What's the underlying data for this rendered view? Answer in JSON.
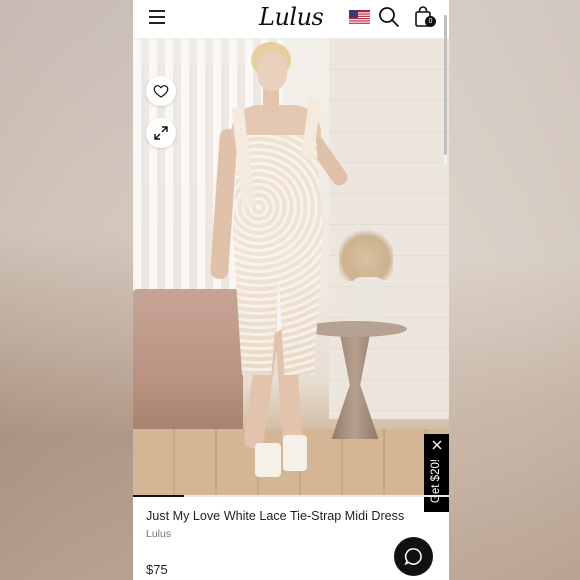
{
  "header": {
    "logo": "Lulus",
    "bag_count": "0"
  },
  "icons": {
    "menu": "hamburger-menu-icon",
    "flag": "us-flag-icon",
    "search": "search-icon",
    "bag": "shopping-bag-icon",
    "favorite": "heart-icon",
    "expand": "expand-arrows-icon",
    "promo_close": "close-icon",
    "chat": "chat-bubble-icon"
  },
  "gallery": {
    "progress": 0.16
  },
  "promo": {
    "label": "Get $20!"
  },
  "product": {
    "title": "Just My Love White Lace Tie-Strap Midi Dress",
    "brand": "Lulus",
    "price": "$75"
  },
  "colors": {
    "accent": "#111111",
    "brand_text": "#777777"
  }
}
